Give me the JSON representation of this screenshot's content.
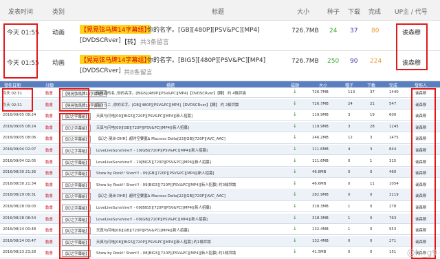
{
  "top": {
    "headers": {
      "time": "发表时间",
      "cat": "类别",
      "title": "标题",
      "size": "大小",
      "seed": "种子",
      "dl": "下载",
      "done": "完成",
      "up": "UP主 / 代号"
    },
    "rows": [
      {
        "time": "今天 01:55",
        "cat": "动画",
        "tag": "【晃晃弦马牌14字幕组】",
        "l1": "你的名字。[GB][480P][PSV&PC][MP4]",
        "l2a": "[DVDSCRver]",
        "l2b": "【转】",
        "l2c": "共3条留言",
        "size": "726.7MB",
        "seed": "24",
        "dl": "37",
        "done": "80",
        "up": "诶森穆"
      },
      {
        "time": "今天 01:55",
        "cat": "动画",
        "tag": "【晃晃弦马牌14字幕组】",
        "l1": "你的名字。[BIG5][480P][PSV&PC][MP4]",
        "l2a": "[DVDSCRver]",
        "l2b": "",
        "l2c": "共8条留言",
        "size": "726.7MB",
        "seed": "250",
        "dl": "90",
        "done": "224",
        "up": "诶森穆"
      }
    ]
  },
  "bottom": {
    "headers": {
      "time": "發佈日期",
      "cat": "分類",
      "title": "標題",
      "dl": "磁鏈",
      "size": "大小",
      "seed": "種子",
      "leech": "下載",
      "done": "完成",
      "pub": "發佈人"
    },
    "rows": [
      {
        "time": "今天 02:31",
        "cat": "動畫",
        "tag": "【晃晃弦馬牌14字幕組】",
        "title": "你無處的名 ,你的名字。[BIG5][480P][PSV&PC][MP4]【DVDSCRver】【轉】 约 4條評論",
        "size": "726.7MB",
        "seed": "113",
        "leech": "37",
        "done": "1440",
        "pub": "诶森穆"
      },
      {
        "time": "今天 02:31",
        "cat": "動畫",
        "tag": "【晃晃弦馬牌14字幕組】",
        "title": "でうらこ ,你的名字。[GB][480P][PSV&PC][MP4]【DVDSCRver】【轉】 约 2條評論",
        "size": "726.7MB",
        "seed": "24",
        "leech": "21",
        "done": "547",
        "pub": "诶森穆"
      },
      {
        "time": "2016/09/05 08:24",
        "cat": "動畫",
        "tag": "【幻之字幕組】",
        "title": "天真与闪电[09][BIG5][720P][PSV&PC][MP4][新人招募]",
        "size": "119.9MB",
        "seed": "3",
        "leech": "19",
        "done": "600",
        "pub": "诶森穆"
      },
      {
        "time": "2016/09/05 08:24",
        "cat": "動畫",
        "tag": "【幻之字幕組】",
        "title": "天真与闪电[09][GB][720P][PSV&PC][MP4][新人招募]",
        "size": "119.9MB",
        "seed": "3",
        "leech": "28",
        "done": "1245",
        "pub": "诶森穆"
      },
      {
        "time": "2016/09/05 08:06",
        "cat": "動畫",
        "tag": "【幻之字幕組】",
        "title": "【幻之·澳洲·DHR】超时空要塞Δ Macross Delta[23][GB][720P][AVC_AAC]",
        "size": "246.2MB",
        "seed": "12",
        "leech": "3",
        "done": "1475",
        "pub": "诶森穆"
      },
      {
        "time": "2016/09/04 02:07",
        "cat": "動畫",
        "tag": "【幻之字幕組】",
        "title": "LoveLiveSunshine!! - 10[GB][720P][PSV&PC][MP4][新人招募]",
        "size": "111.6MB",
        "seed": "4",
        "leech": "3",
        "done": "844",
        "pub": "诶森穆"
      },
      {
        "time": "2016/09/04 02:05",
        "cat": "動畫",
        "tag": "【幻之字幕組】",
        "title": "LoveLiveSunshine!! - 10[BIG5][720P][PSV&PC][MP4][新人招募]",
        "size": "111.6MB",
        "seed": "0",
        "leech": "1",
        "done": "315",
        "pub": "诶森穆"
      },
      {
        "time": "2016/08/30 21:36",
        "cat": "動畫",
        "tag": "【幻之字幕組】",
        "title": "Show by Rock!! Short!! - 09[GB][720P][PSV&PC][MP4][新人招募]",
        "size": "46.8MB",
        "seed": "0",
        "leech": "0",
        "done": "460",
        "pub": "诶森穆"
      },
      {
        "time": "2016/08/30 21:34",
        "cat": "動畫",
        "tag": "【幻之字幕組】",
        "title": "Show by Rock!! Short!! - 09[BIG5][720P][PSV&PC][MP4][新人招募] 约3條評論",
        "size": "46.6MB",
        "seed": "0",
        "leech": "11",
        "done": "1054",
        "pub": "诶森穆"
      },
      {
        "time": "2016/08/29 06:31",
        "cat": "動畫",
        "tag": "【幻之字幕組】",
        "title": "【幻之·澳洲·DHR】超时空要塞Δ Macross Delta[22][GB][720P][AVC_AAC]",
        "size": "282.9MB",
        "seed": "0",
        "leech": "0",
        "done": "3119",
        "pub": "诶森穆"
      },
      {
        "time": "2016/08/28 09:03",
        "cat": "動畫",
        "tag": "【幻之字幕組】",
        "title": "LoveLiveSunshine!! - 09[BIG5][720P][PSV&PC][MP4][新人招募]",
        "size": "318.3MB",
        "seed": "1",
        "leech": "0",
        "done": "278",
        "pub": "诶森穆"
      },
      {
        "time": "2016/08/28 08:54",
        "cat": "動畫",
        "tag": "【幻之字幕組】",
        "title": "LoveLiveSunshine!! - 09[GB][720P][PSV&PC][MP4][新人招募]",
        "size": "318.3MB",
        "seed": "1",
        "leech": "0",
        "done": "763",
        "pub": "诶森穆"
      },
      {
        "time": "2016/08/24 00:48",
        "cat": "動畫",
        "tag": "【幻之字幕組】",
        "title": "天真与闪电[08][GB][720P][PSV&PC][MP4][新人招募]",
        "size": "132.4MB",
        "seed": "1",
        "leech": "0",
        "done": "953",
        "pub": "诶森穆"
      },
      {
        "time": "2016/08/24 00:47",
        "cat": "動畫",
        "tag": "【幻之字幕組】",
        "title": "天真与闪电[08][BIG5][720P][PSV&PC][MP4][新人招募] 约1條評論",
        "size": "132.4MB",
        "seed": "0",
        "leech": "0",
        "done": "271",
        "pub": "诶森穆"
      },
      {
        "time": "2016/08/23 23:28",
        "cat": "動畫",
        "tag": "【幻之字幕組】",
        "title": "Show by Rock!! Short!! - 08[BIG5][720P][PSV&PC][MP4][新人招募] 约1條評論",
        "size": "41.5MB",
        "seed": "0",
        "leech": "0",
        "done": "151",
        "pub": "诶森穆"
      }
    ]
  },
  "watermark": "@hi_g9"
}
